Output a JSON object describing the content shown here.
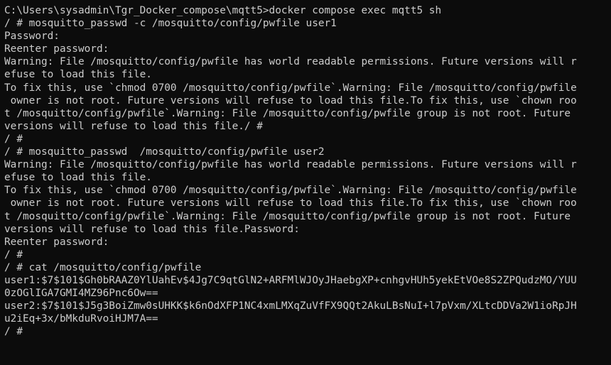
{
  "terminal": {
    "lines": [
      "C:\\Users\\sysadmin\\Tgr_Docker_compose\\mqtt5>docker compose exec mqtt5 sh",
      "/ # mosquitto_passwd -c /mosquitto/config/pwfile user1",
      "Password:",
      "Reenter password:",
      "Warning: File /mosquitto/config/pwfile has world readable permissions. Future versions will r",
      "efuse to load this file.",
      "To fix this, use `chmod 0700 /mosquitto/config/pwfile`.Warning: File /mosquitto/config/pwfile",
      " owner is not root. Future versions will refuse to load this file.To fix this, use `chown roo",
      "t /mosquitto/config/pwfile`.Warning: File /mosquitto/config/pwfile group is not root. Future",
      "versions will refuse to load this file./ #",
      "/ #",
      "/ # mosquitto_passwd  /mosquitto/config/pwfile user2",
      "Warning: File /mosquitto/config/pwfile has world readable permissions. Future versions will r",
      "efuse to load this file.",
      "To fix this, use `chmod 0700 /mosquitto/config/pwfile`.Warning: File /mosquitto/config/pwfile",
      " owner is not root. Future versions will refuse to load this file.To fix this, use `chown roo",
      "t /mosquitto/config/pwfile`.Warning: File /mosquitto/config/pwfile group is not root. Future",
      "versions will refuse to load this file.Password:",
      "Reenter password:",
      "/ #",
      "/ # cat /mosquitto/config/pwfile",
      "user1:$7$101$Gh0bRAAZ0YlUahEv$4Jg7C9qtGlN2+ARFMlWJOyJHaebgXP+cnhgvHUh5yekEtVOe8S2ZPQudzMO/YUU",
      "0zOGlIGA7GMI4MZ96Pnc6Ow==",
      "user2:$7$101$J5g3BoiZmw0sUHKK$k6nOdXFP1NC4xmLMXqZuVfFX9QQt2AkuLBsNuI+l7pVxm/XLtcDDVa2W1ioRpJH",
      "u2iEq+3x/bMkduRvoiHJM7A==",
      "/ #"
    ]
  }
}
